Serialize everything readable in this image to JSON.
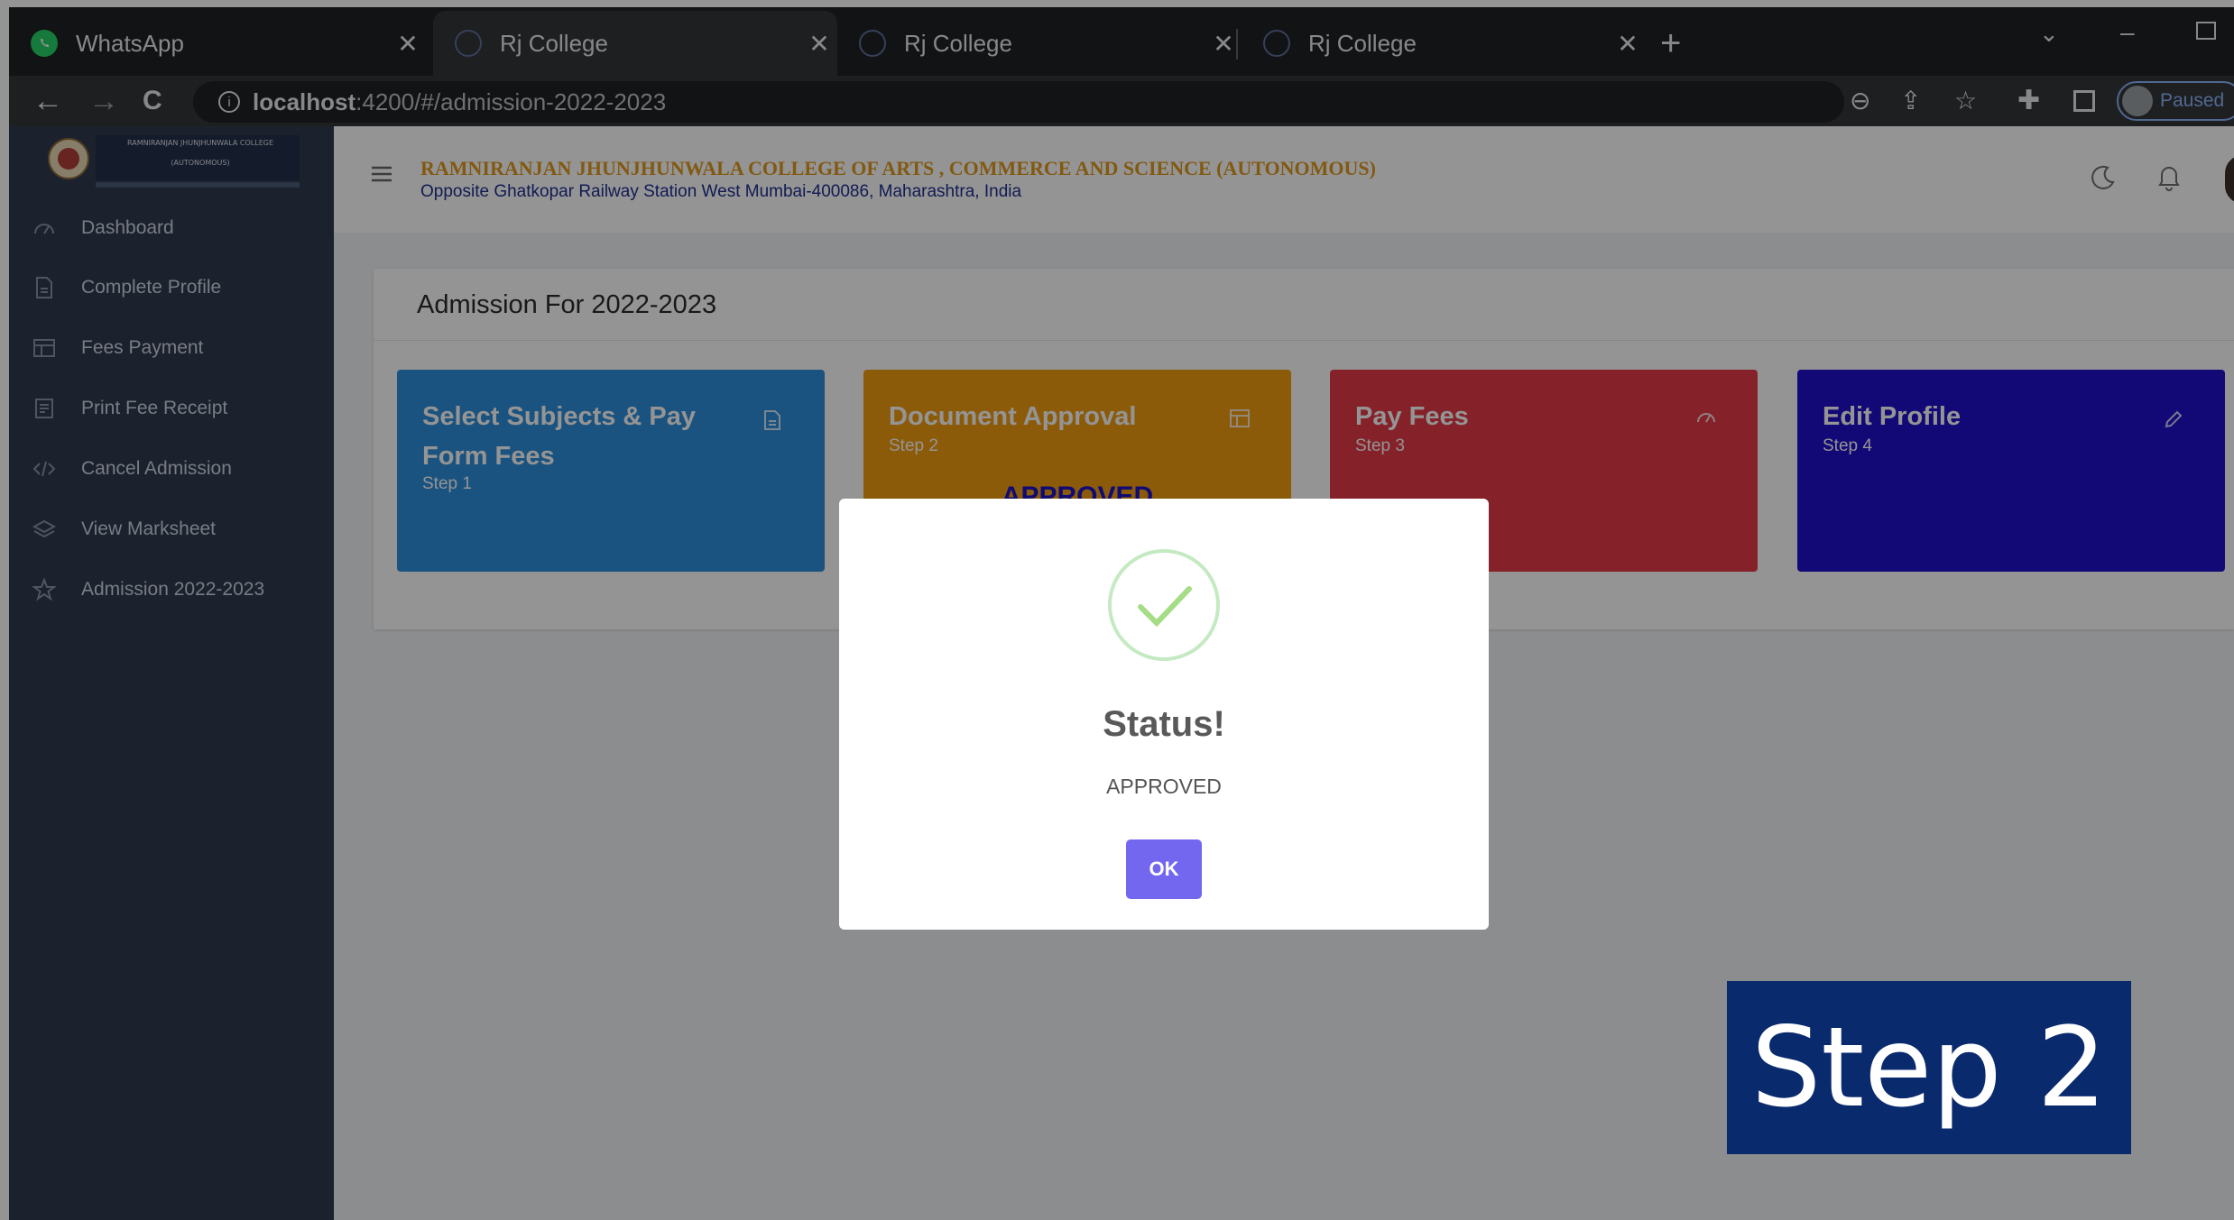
{
  "browser": {
    "tabs": [
      {
        "title": "WhatsApp",
        "active": false
      },
      {
        "title": "Rj College",
        "active": true
      },
      {
        "title": "Rj College",
        "active": false
      },
      {
        "title": "Rj College",
        "active": false
      }
    ],
    "new_tab": "+",
    "url_host": "localhost",
    "url_path": ":4200/#/admission-2022-2023",
    "profile_status": "Paused"
  },
  "sidebar": {
    "logo_text": [
      "RAMNIRANJAN JHUNJHUNWALA COLLEGE",
      "(AUTONOMOUS)"
    ],
    "items": [
      {
        "label": "Dashboard",
        "icon": "dashboard-icon"
      },
      {
        "label": "Complete Profile",
        "icon": "document-icon"
      },
      {
        "label": "Fees Payment",
        "icon": "table-icon"
      },
      {
        "label": "Print Fee Receipt",
        "icon": "receipt-icon"
      },
      {
        "label": "Cancel Admission",
        "icon": "code-icon"
      },
      {
        "label": "View Marksheet",
        "icon": "layers-icon"
      },
      {
        "label": "Admission 2022-2023",
        "icon": "star-icon"
      }
    ]
  },
  "header": {
    "college_name": "RAMNIRANJAN JHUNJHUNWALA COLLEGE OF ARTS , COMMERCE AND SCIENCE (AUTONOMOUS)",
    "address": "Opposite Ghatkopar Railway Station West Mumbai-400086, Maharashtra, India"
  },
  "page": {
    "title": "Admission For 2022-2023",
    "cards": [
      {
        "title": "Select Subjects & Pay Form Fees",
        "step": "Step 1",
        "color": "#2d8fdc",
        "icon": "document-icon",
        "status": ""
      },
      {
        "title": "Document Approval",
        "step": "Step 2",
        "color": "#f29d12",
        "icon": "table-icon",
        "status": "APPROVED"
      },
      {
        "title": "Pay Fees",
        "step": "Step 3",
        "color": "#e53a48",
        "icon": "dashboard-icon",
        "status": ""
      },
      {
        "title": "Edit Profile",
        "step": "Step 4",
        "color": "#2010ce",
        "icon": "pencil-icon",
        "status": ""
      }
    ]
  },
  "modal": {
    "title": "Status!",
    "text": "APPROVED",
    "button": "OK"
  },
  "overlay_caption": "Step 2",
  "colors": {
    "accent": "#7367f0",
    "success": "#a5dc86",
    "sidebar": "#2f3a4f",
    "college_name": "#e09a1e",
    "caption_bg": "#0a2a6e"
  }
}
